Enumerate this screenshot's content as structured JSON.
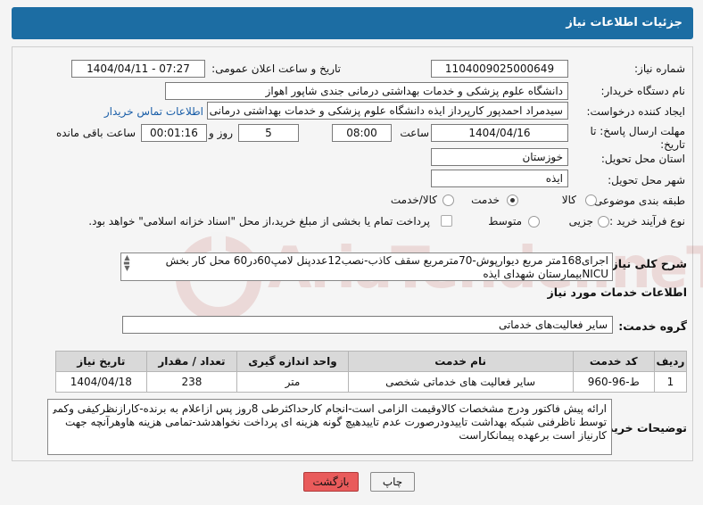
{
  "header": {
    "title": "جزئیات اطلاعات نیاز"
  },
  "form": {
    "need_number_label": "شماره نیاز:",
    "need_number": "1104009025000649",
    "announce_label": "تاریخ و ساعت اعلان عمومی:",
    "announce_value": "1404/04/11 - 07:27",
    "buyer_org_label": "نام دستگاه خریدار:",
    "buyer_org": "دانشگاه علوم پزشکی و خدمات بهداشتی درمانی جندی شاپور اهواز",
    "creator_label": "ایجاد کننده درخواست:",
    "creator": "سیدمراد احمدپور کارپرداز ایذه دانشگاه علوم پزشکی و خدمات بهداشتی درمانی",
    "contact_link": "اطلاعات تماس خریدار",
    "deadline_label_1": "مهلت ارسال پاسخ: تا",
    "deadline_label_2": "تاریخ:",
    "deadline_date": "1404/04/16",
    "time_label": "ساعت",
    "deadline_time": "08:00",
    "days_value": "5",
    "days_label": "روز و",
    "remaining_time": "00:01:16",
    "remaining_label": "ساعت باقی مانده",
    "province_label": "استان محل تحویل:",
    "province": "خوزستان",
    "city_label": "شهر محل تحویل:",
    "city": "ایذه",
    "category_label": "طبقه بندی موضوعی:",
    "category_options": [
      "کالا",
      "خدمت",
      "کالا/خدمت"
    ],
    "category_selected": "خدمت",
    "process_label": "نوع فرآیند خرید :",
    "process_options": [
      "جزیی",
      "متوسط"
    ],
    "payment_note": "پرداخت تمام یا بخشی از مبلغ خرید،از محل \"اسناد خزانه اسلامی\" خواهد بود."
  },
  "description": {
    "label": "شرح کلی نیاز:",
    "line1": "اجرای168متر مربع دیوارپوش-70مترمربع سقف کاذب-نصب12عددپنل لامپ60در60 محل کار بخش",
    "line2": "NICUبیمارستان شهدای ایذه"
  },
  "services": {
    "section_title": "اطلاعات خدمات مورد نیاز",
    "group_label": "گروه خدمت:",
    "group_value": "سایر فعالیت‌های خدماتی",
    "columns": [
      "ردیف",
      "کد خدمت",
      "نام خدمت",
      "واحد اندازه گیری",
      "تعداد / مقدار",
      "تاریخ نیاز"
    ],
    "rows": [
      [
        "1",
        "ط-96-960",
        "سایر فعالیت های خدماتی شخصی",
        "متر",
        "238",
        "1404/04/18"
      ]
    ]
  },
  "buyer_notes": {
    "label": "توضیحات خریدار:",
    "line1": "ارائه پیش فاکتور ودرج مشخصات کالاوقیمت الزامی است-انجام کارحداکثرطی 8روز پس ازاعلام به برنده-کارازنظرکیفی وکمی",
    "line2": "توسط ناظرفنی شبکه بهداشت تاییدودرصورت عدم تاییدهیچ گونه هزینه ای پرداخت نخواهدشد-تمامی هزینه هاوهرآنچه جهت",
    "line3": "کارنیاز است برعهده پیمانکاراست"
  },
  "buttons": {
    "print": "چاپ",
    "back": "بازگشت"
  },
  "watermark": {
    "text": "AriaTender.neT"
  },
  "colors": {
    "header": "#1c6da3",
    "back_button": "#e95b5b",
    "link": "#1a5ea8"
  }
}
